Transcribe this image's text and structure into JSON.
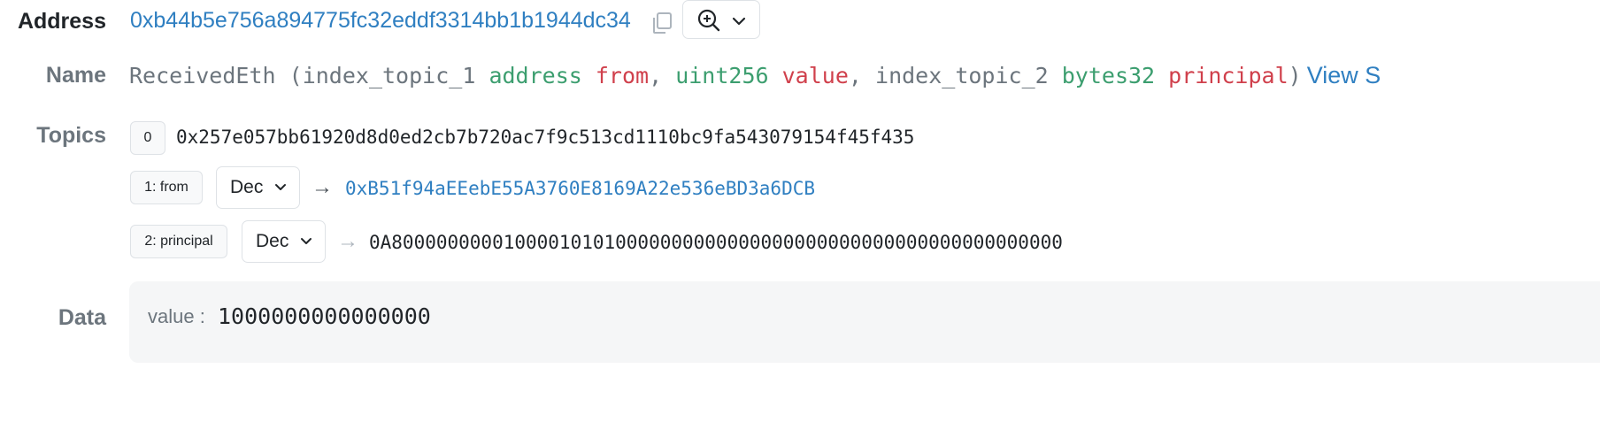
{
  "address": {
    "label": "Address",
    "value": "0xb44b5e756a894775fc32eddf3314bb1b1944dc34",
    "copy_icon": "copy-icon",
    "zoom_icon": "zoom-in-icon",
    "dropdown_icon": "chevron-down-icon"
  },
  "name": {
    "label": "Name",
    "event_name": "ReceivedEth",
    "open_paren": "(",
    "params": [
      {
        "prefix": "index_topic_1",
        "type": "address",
        "name": "from",
        "sep": ","
      },
      {
        "prefix": "",
        "type": "uint256",
        "name": "value",
        "sep": ","
      },
      {
        "prefix": "index_topic_2",
        "type": "bytes32",
        "name": "principal",
        "sep": ""
      }
    ],
    "close_paren": ")",
    "view_link": "View S"
  },
  "topics": {
    "label": "Topics",
    "items": [
      {
        "badge": "0",
        "value": "0x257e057bb61920d8d0ed2cb7b720ac7f9c513cd1110bc9fa543079154f45f435"
      },
      {
        "badge": "1: from",
        "format": "Dec",
        "arrow": "→",
        "value": "0xB51f94aEEebE55A3760E8169A22e536eBD3a6DCB"
      },
      {
        "badge": "2: principal",
        "format": "Dec",
        "arrow": "→",
        "value": "0A800000000010000101010000000000000000000000000000000000000000"
      }
    ]
  },
  "data": {
    "label": "Data",
    "key": "value :",
    "value": "1000000000000000"
  },
  "colors": {
    "link": "#2f7fc1",
    "type": "#3c9e6f",
    "param_name": "#d0404c",
    "muted": "#6c757d"
  }
}
